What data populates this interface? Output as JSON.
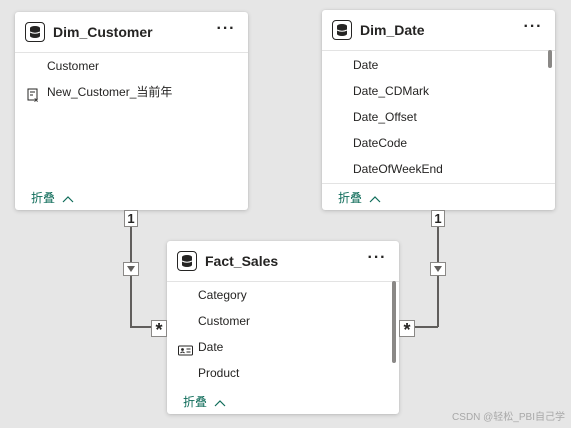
{
  "tables": {
    "dim_customer": {
      "title": "Dim_Customer",
      "fields": [
        "Customer",
        "New_Customer_当前年"
      ],
      "collapse_label": "折叠"
    },
    "dim_date": {
      "title": "Dim_Date",
      "fields": [
        "Date",
        "Date_CDMark",
        "Date_Offset",
        "DateCode",
        "DateOfWeekEnd"
      ],
      "collapse_label": "折叠"
    },
    "fact_sales": {
      "title": "Fact_Sales",
      "fields": [
        "Category",
        "Customer",
        "Date",
        "Product"
      ],
      "collapse_label": "折叠"
    }
  },
  "relationships": {
    "customer_sales": {
      "one_side": "1",
      "many_side": "*"
    },
    "date_sales": {
      "one_side": "1",
      "many_side": "*"
    }
  },
  "icons": {
    "table": "database-icon",
    "more": "more-options-icon",
    "measure": "calculated-measure-icon",
    "key_field": "key-field-icon",
    "chevron": "chevron-up-icon",
    "filter_direction": "filter-direction-icon"
  },
  "more_glyph": "···",
  "watermark": "CSDN @轻松_PBI自己学",
  "colors": {
    "canvas": "#e6e6e6",
    "card": "#ffffff",
    "accent": "#0f6c5a",
    "line": "#605e5c"
  }
}
